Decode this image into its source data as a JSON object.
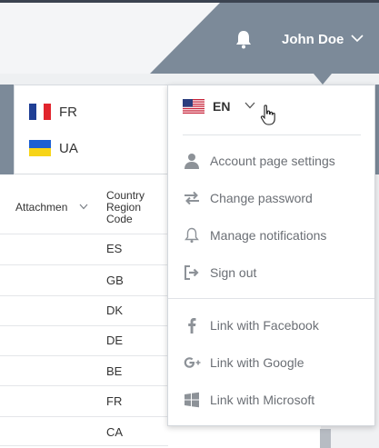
{
  "header": {
    "user_name": "John Doe",
    "bell_icon": "bell-icon",
    "colors": {
      "slab": "#7c8a99",
      "top_line": "#3b4350"
    }
  },
  "table": {
    "columns": [
      {
        "label": "Attachmen"
      },
      {
        "label": "Country Region Code"
      }
    ],
    "rows": [
      "ES",
      "GB",
      "DK",
      "DE",
      "BE",
      "FR",
      "CA"
    ]
  },
  "language_panel": {
    "items": [
      {
        "code": "FR",
        "flag": "france-flag-icon"
      },
      {
        "code": "UA",
        "flag": "ukraine-flag-icon"
      }
    ]
  },
  "user_menu": {
    "selected_language": {
      "code": "EN",
      "flag": "us-flag-icon"
    },
    "items": [
      {
        "label": "Account page settings",
        "icon": "user-icon"
      },
      {
        "label": "Change password",
        "icon": "arrows-swap-icon"
      },
      {
        "label": "Manage notifications",
        "icon": "bell-icon"
      },
      {
        "label": "Sign out",
        "icon": "sign-out-icon"
      }
    ],
    "social_items": [
      {
        "label": "Link with Facebook",
        "icon": "facebook-icon"
      },
      {
        "label": "Link with Google",
        "icon": "google-plus-icon"
      },
      {
        "label": "Link with Microsoft",
        "icon": "windows-icon"
      }
    ]
  }
}
